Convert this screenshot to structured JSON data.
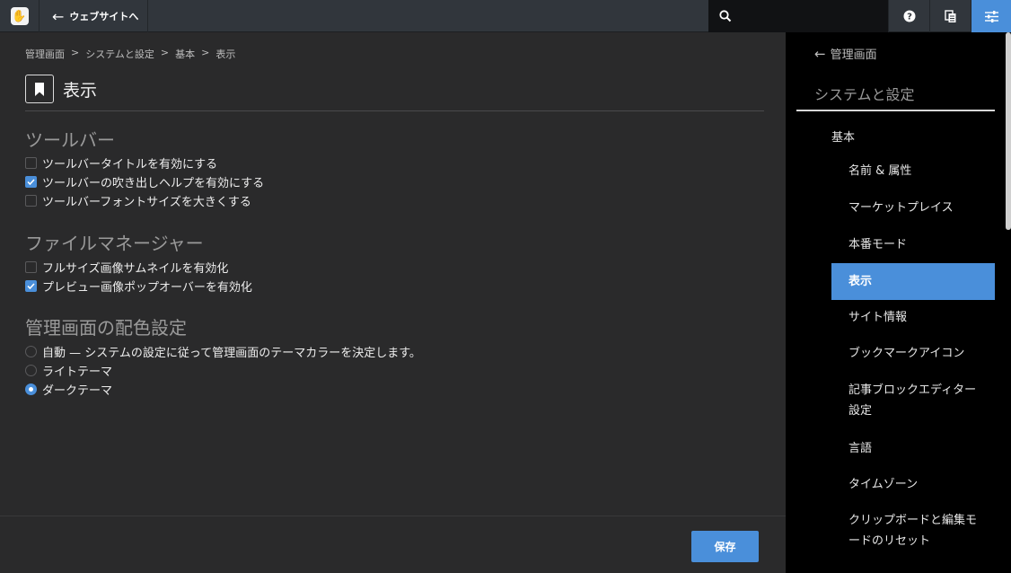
{
  "topbar": {
    "logo_glyph": "✋",
    "back_to_site": "ウェブサイトへ",
    "icons": [
      "search-icon",
      "help-icon",
      "documents-icon",
      "settings-sliders-icon"
    ]
  },
  "breadcrumb": [
    "管理画面",
    ">",
    "システムと設定",
    ">",
    "基本",
    ">",
    "表示"
  ],
  "page": {
    "title": "表示"
  },
  "sections": {
    "toolbar": {
      "title": "ツールバー",
      "options": [
        {
          "label": "ツールバータイトルを有効にする",
          "checked": false
        },
        {
          "label": "ツールバーの吹き出しヘルプを有効にする",
          "checked": true
        },
        {
          "label": "ツールバーフォントサイズを大きくする",
          "checked": false
        }
      ]
    },
    "file_manager": {
      "title": "ファイルマネージャー",
      "options": [
        {
          "label": "フルサイズ画像サムネイルを有効化",
          "checked": false
        },
        {
          "label": "プレビュー画像ポップオーバーを有効化",
          "checked": true
        }
      ]
    },
    "color_scheme": {
      "title": "管理画面の配色設定",
      "options": [
        {
          "label": "自動 — システムの設定に従って管理画面のテーマカラーを決定します。",
          "selected": false
        },
        {
          "label": "ライトテーマ",
          "selected": false
        },
        {
          "label": "ダークテーマ",
          "selected": true
        }
      ]
    }
  },
  "footer": {
    "save_label": "保存"
  },
  "sidebar": {
    "back_label": "管理画面",
    "title": "システムと設定",
    "group": "基本",
    "items": [
      {
        "label": "名前 & 属性",
        "active": false
      },
      {
        "label": "マーケットプレイス",
        "active": false
      },
      {
        "label": "本番モード",
        "active": false
      },
      {
        "label": "表示",
        "active": true
      },
      {
        "label": "サイト情報",
        "active": false
      },
      {
        "label": "ブックマークアイコン",
        "active": false
      },
      {
        "label": "記事ブロックエディター設定",
        "active": false
      },
      {
        "label": "言語",
        "active": false
      },
      {
        "label": "タイムゾーン",
        "active": false
      },
      {
        "label": "クリップボードと編集モードのリセット",
        "active": false
      }
    ]
  },
  "colors": {
    "accent": "#4a8fda",
    "background": "#2a2a2b",
    "sidebar": "#000000",
    "topbar": "#31363c"
  }
}
